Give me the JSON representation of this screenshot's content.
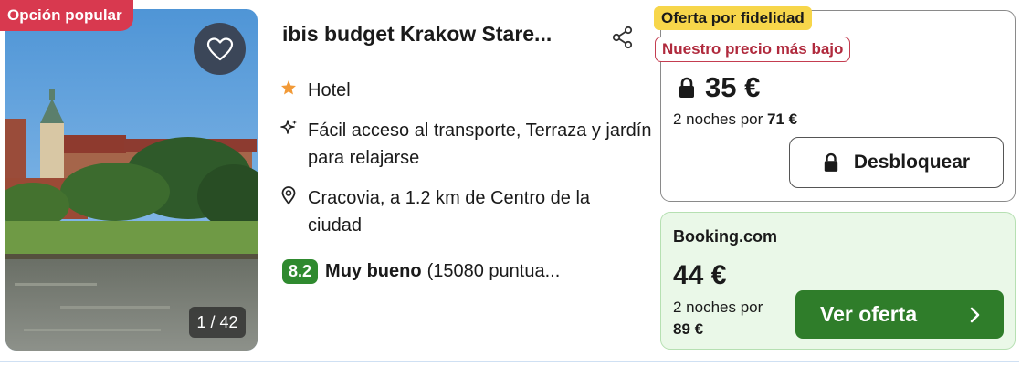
{
  "listing": {
    "badge": "Opción popular",
    "title": "ibis budget Krakow Stare...",
    "photo_counter": "1 / 42",
    "type": "Hotel",
    "features": "Fácil acceso al transporte, Terraza y jardín para relajarse",
    "location": "Cracovia, a 1.2 km de Centro de la ciudad",
    "rating": {
      "score": "8.2",
      "label": "Muy bueno",
      "count": "(15080 puntua..."
    }
  },
  "deal_loyalty": {
    "tag": "Oferta por fidelidad",
    "sub_tag": "Nuestro precio más bajo",
    "price": "35 €",
    "nights_prefix": "2 noches por",
    "nights_total": "71 €",
    "button": "Desbloquear"
  },
  "deal_booking": {
    "provider": "Booking.com",
    "price": "44 €",
    "nights_prefix": "2 noches por",
    "nights_total": "89 €",
    "button": "Ver oferta"
  },
  "colors": {
    "popular_badge": "#d8394f",
    "loyalty_tag": "#f7d64a",
    "lowest_price_text": "#b02a3d",
    "score_badge": "#2f8a2f",
    "offer_button": "#2f7d2a",
    "booking_panel_bg": "#eaf8e8"
  },
  "icons": [
    "heart-icon",
    "share-icon",
    "star-icon",
    "sparkle-icon",
    "location-pin-icon",
    "lock-icon",
    "chevron-right-icon"
  ]
}
